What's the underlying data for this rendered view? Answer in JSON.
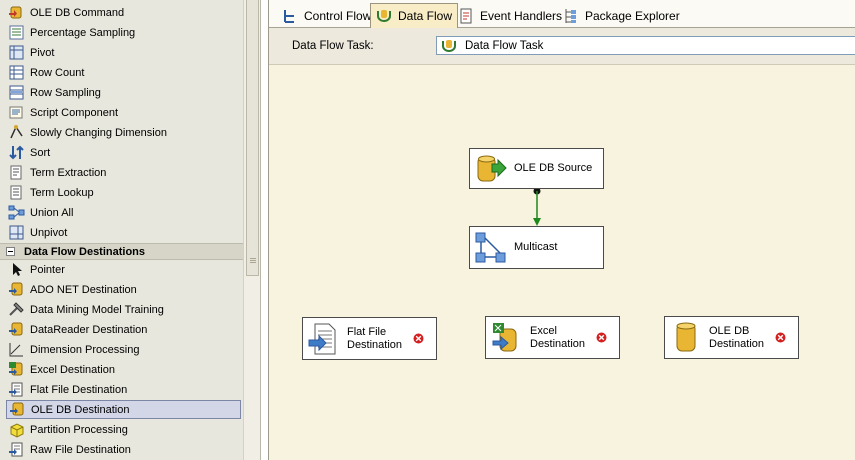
{
  "toolbox": {
    "transform_items": [
      {
        "label": "OLE DB Command",
        "icon": "ole-db-command-icon"
      },
      {
        "label": "Percentage Sampling",
        "icon": "percentage-sampling-icon"
      },
      {
        "label": "Pivot",
        "icon": "pivot-icon"
      },
      {
        "label": "Row Count",
        "icon": "row-count-icon"
      },
      {
        "label": "Row Sampling",
        "icon": "row-sampling-icon"
      },
      {
        "label": "Script Component",
        "icon": "script-component-icon"
      },
      {
        "label": "Slowly Changing Dimension",
        "icon": "slowly-changing-dimension-icon"
      },
      {
        "label": "Sort",
        "icon": "sort-icon"
      },
      {
        "label": "Term Extraction",
        "icon": "term-extraction-icon"
      },
      {
        "label": "Term Lookup",
        "icon": "term-lookup-icon"
      },
      {
        "label": "Union All",
        "icon": "union-all-icon"
      },
      {
        "label": "Unpivot",
        "icon": "unpivot-icon"
      }
    ],
    "destinations_header": "Data Flow Destinations",
    "destination_items": [
      {
        "label": "Pointer",
        "icon": "pointer-icon"
      },
      {
        "label": "ADO NET Destination",
        "icon": "ado-net-destination-icon"
      },
      {
        "label": "Data Mining Model Training",
        "icon": "data-mining-icon"
      },
      {
        "label": "DataReader Destination",
        "icon": "datareader-destination-icon"
      },
      {
        "label": "Dimension Processing",
        "icon": "dimension-processing-icon"
      },
      {
        "label": "Excel Destination",
        "icon": "excel-destination-icon"
      },
      {
        "label": "Flat File Destination",
        "icon": "flat-file-destination-icon"
      },
      {
        "label": "OLE DB Destination",
        "icon": "ole-db-destination-icon",
        "selected": true
      },
      {
        "label": "Partition Processing",
        "icon": "partition-processing-icon"
      },
      {
        "label": "Raw File Destination",
        "icon": "raw-file-destination-icon"
      }
    ]
  },
  "tabs": [
    {
      "label": "Control Flow",
      "icon": "control-flow-icon",
      "active": false
    },
    {
      "label": "Data Flow",
      "icon": "data-flow-icon",
      "active": true
    },
    {
      "label": "Event Handlers",
      "icon": "event-handlers-icon",
      "active": false
    },
    {
      "label": "Package Explorer",
      "icon": "package-explorer-icon",
      "active": false
    }
  ],
  "task_bar": {
    "label": "Data Flow Task:",
    "selected_value": "Data Flow Task"
  },
  "components": {
    "source": {
      "label": "OLE DB Source"
    },
    "multicast": {
      "label": "Multicast"
    },
    "flat_file": {
      "line1": "Flat File",
      "line2": "Destination",
      "has_error": true
    },
    "excel": {
      "line1": "Excel",
      "line2": "Destination",
      "has_error": true
    },
    "ole_db_dest": {
      "line1": "OLE DB",
      "line2": "Destination",
      "has_error": true
    }
  },
  "colors": {
    "canvas_bg": "#f7f3df",
    "toolbox_bg": "#e8e7dd",
    "path_green": "#1e8a1e",
    "error_red": "#d32020"
  }
}
